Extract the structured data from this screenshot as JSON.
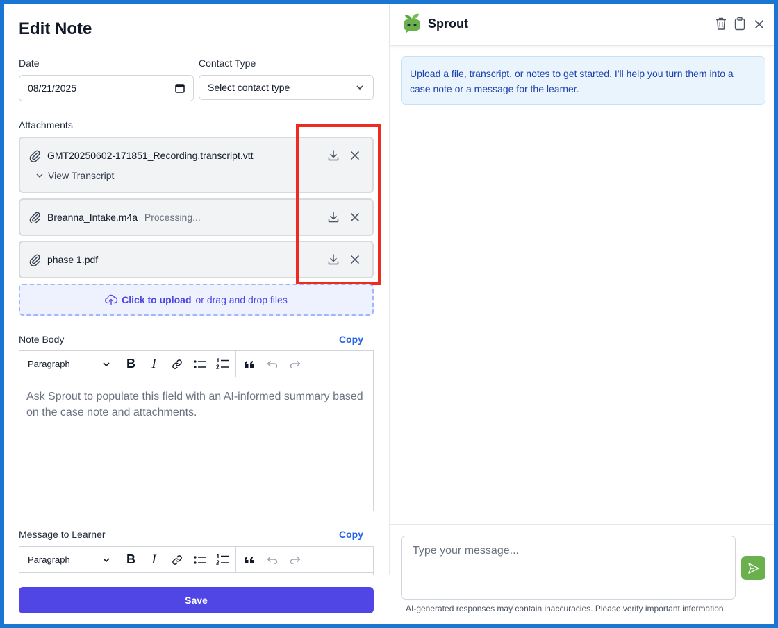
{
  "form": {
    "title": "Edit Note",
    "date_label": "Date",
    "date_value": "08/21/2025",
    "contact_type_label": "Contact Type",
    "contact_type_value": "Select contact type",
    "attachments_label": "Attachments",
    "attachments": [
      {
        "name": "GMT20250602-171851_Recording.transcript.vtt",
        "status": "",
        "toggle_label": "View Transcript"
      },
      {
        "name": "Breanna_Intake.m4a",
        "status": "Processing..."
      },
      {
        "name": "phase 1.pdf",
        "status": ""
      }
    ],
    "upload": {
      "link": "Click to upload",
      "rest": "or drag and drop files"
    },
    "note_body_label": "Note Body",
    "note_body_copy": "Copy",
    "note_body_placeholder": "Ask Sprout to populate this field with an AI-informed summary based on the case note and attachments.",
    "message_label": "Message to Learner",
    "message_copy": "Copy",
    "paragraph_style": "Paragraph",
    "save_label": "Save"
  },
  "assistant": {
    "name": "Sprout",
    "greeting": "Upload a file, transcript, or notes to get started. I'll help you turn them into a case note or a message for the learner.",
    "input_placeholder": "Type your message...",
    "disclaimer": "AI-generated responses may contain inaccuracies. Please verify important information."
  },
  "colors": {
    "accent": "#4f46e5",
    "link": "#2563eb",
    "brand_green": "#6ab04c",
    "highlight": "#ef2b1f",
    "frame": "#1976d2"
  },
  "icons": [
    "paperclip-icon",
    "download-icon",
    "close-icon",
    "chevron-down-icon",
    "calendar-icon",
    "upload-cloud-icon",
    "trash-icon",
    "clipboard-icon",
    "send-icon",
    "sprout-logo"
  ]
}
